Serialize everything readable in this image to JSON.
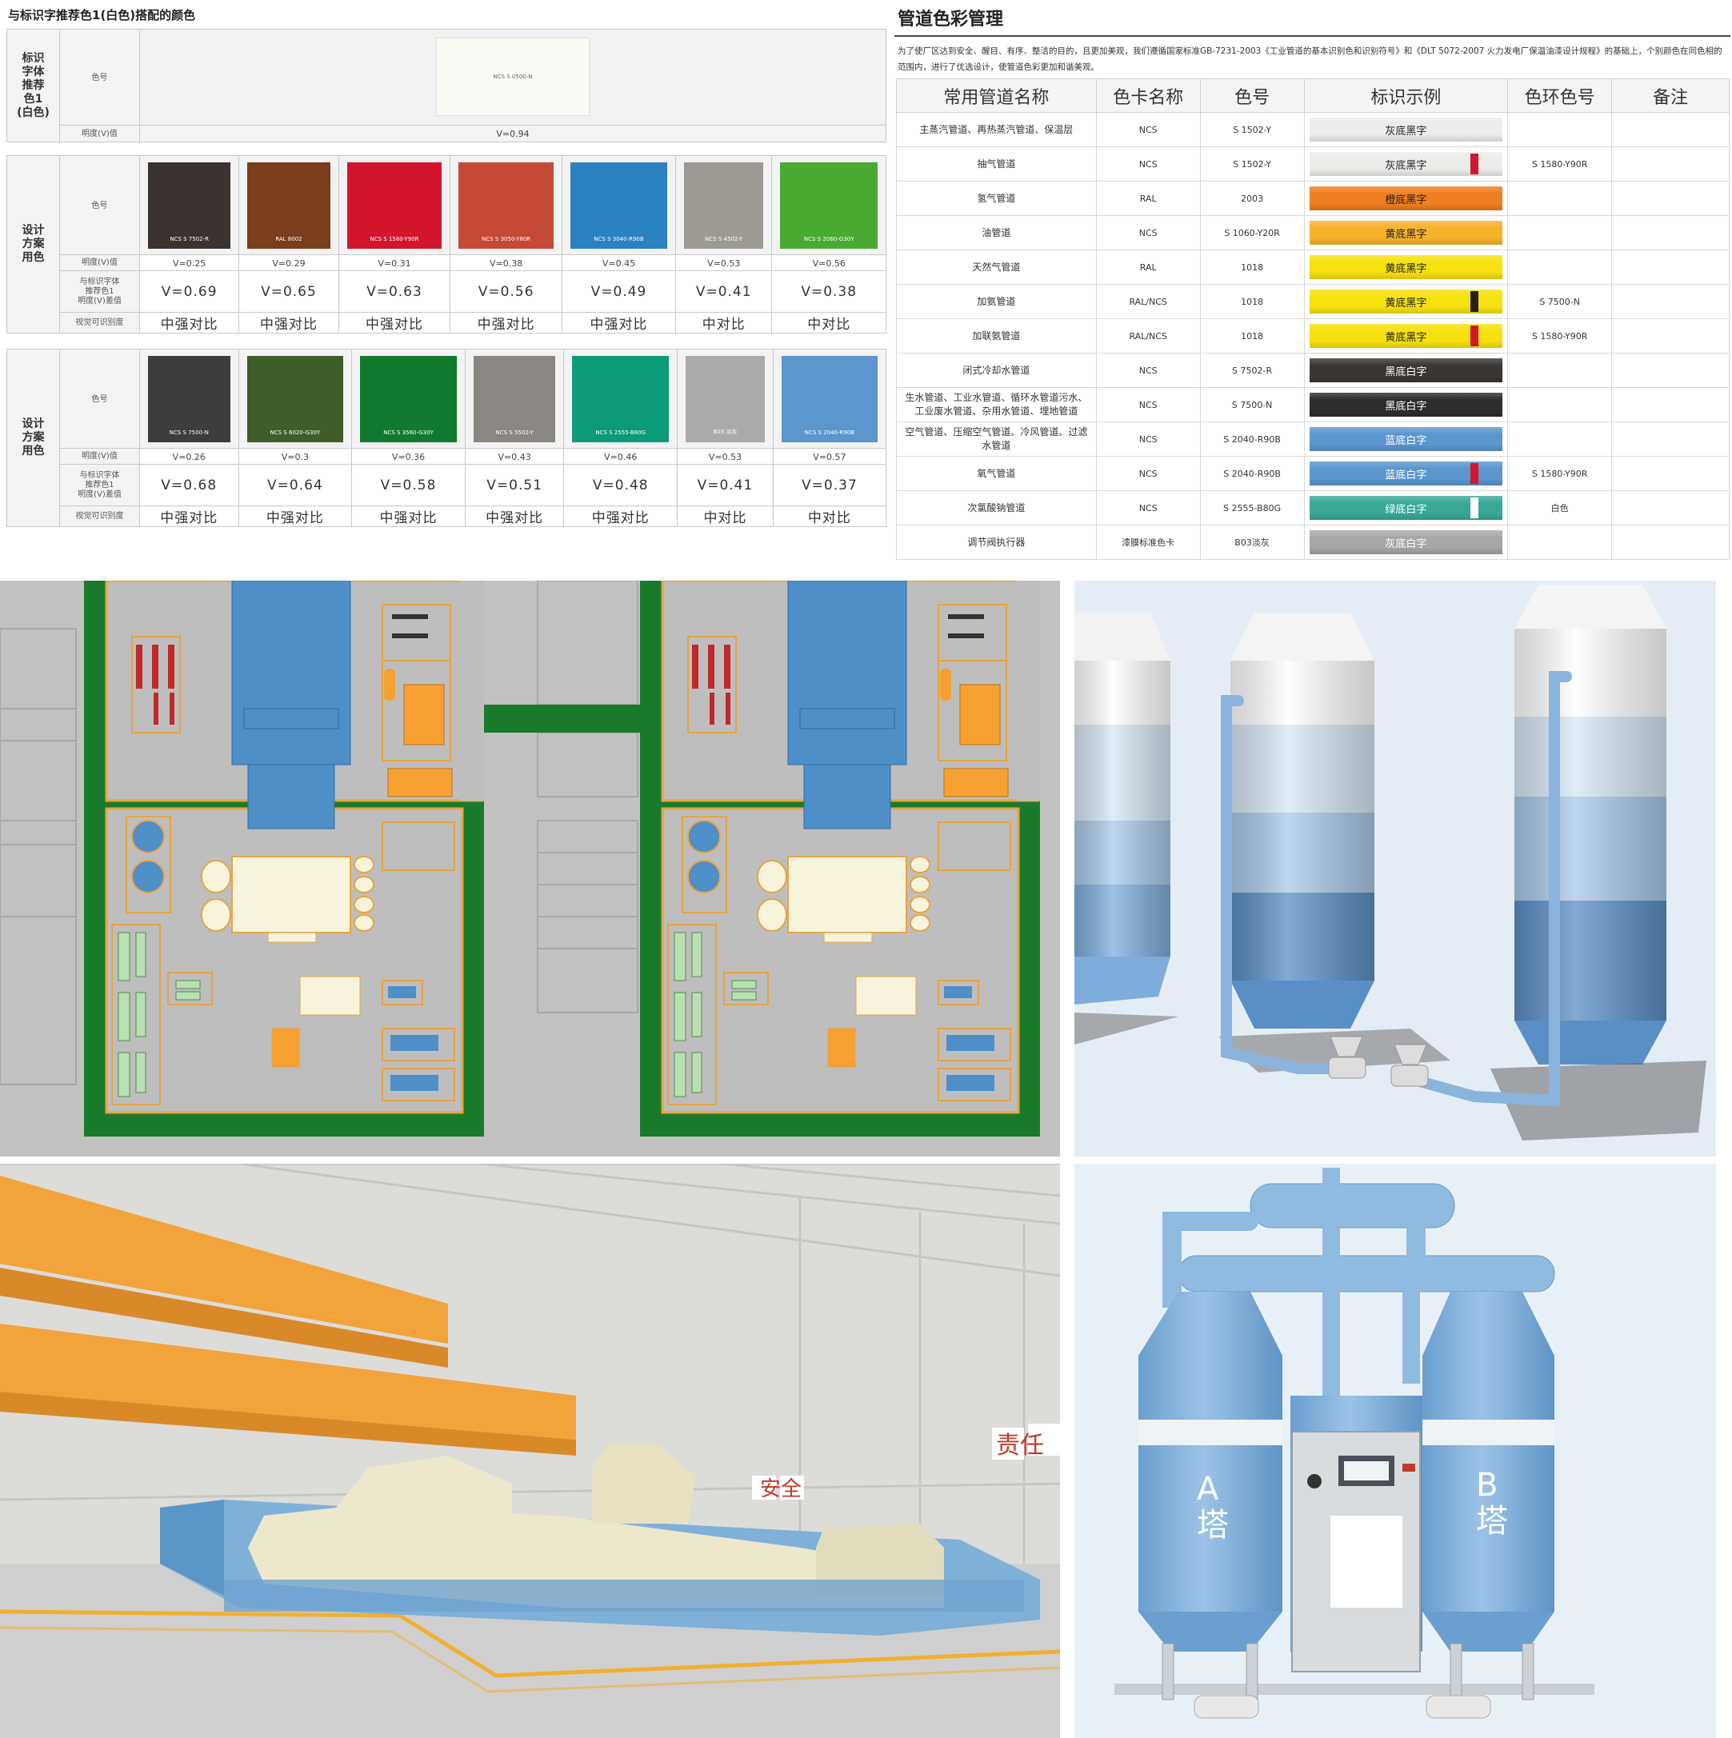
{
  "left_table": {
    "title": "与标识字推荐色1(白色)搭配的颜色",
    "white": {
      "label": "标识\n字体\n推荐\n色1\n(白色)",
      "code_label": "色号",
      "swatch_code": "NCS S 0500-N",
      "swatch_color": "#fbfaf4",
      "v_label": "明度(V)值",
      "v_value": "V=0.94"
    },
    "row_labels": {
      "code": "色号",
      "v": "明度(V)值",
      "diff": "与标识字体\n推荐色1\n明度(V)差值",
      "contrast": "视觉可识别度"
    },
    "schemes": [
      {
        "label": "设计\n方案\n用色",
        "colors": [
          {
            "code": "NCS S 7502-R",
            "hex": "#3a3330",
            "v": "V=0.25",
            "diff": "V=0.69",
            "contrast": "中强对比"
          },
          {
            "code": "RAL 8002",
            "hex": "#7a3e1c",
            "v": "V=0.29",
            "diff": "V=0.65",
            "contrast": "中强对比"
          },
          {
            "code": "NCS S 1580-Y90R",
            "hex": "#d4162d",
            "v": "V=0.31",
            "diff": "V=0.63",
            "contrast": "中强对比"
          },
          {
            "code": "NCS S 3050-Y80R",
            "hex": "#c44a35",
            "v": "V=0.38",
            "diff": "V=0.56",
            "contrast": "中强对比"
          },
          {
            "code": "NCS S 3040-R90B",
            "hex": "#2a82c0",
            "v": "V=0.45",
            "diff": "V=0.49",
            "contrast": "中强对比"
          },
          {
            "code": "NCS S 4502-Y",
            "hex": "#9c9a92",
            "v": "V=0.53",
            "diff": "V=0.41",
            "contrast": "中对比"
          },
          {
            "code": "NCS S 2060-G30Y",
            "hex": "#49aa32",
            "v": "V=0.56",
            "diff": "V=0.38",
            "contrast": "中对比"
          }
        ]
      },
      {
        "label": "设计\n方案\n用色",
        "colors": [
          {
            "code": "NCS S 7500-N",
            "hex": "#3d3d3f",
            "v": "V=0.26",
            "diff": "V=0.68",
            "contrast": "中强对比"
          },
          {
            "code": "NCS S 6020-G30Y",
            "hex": "#3f5e2a",
            "v": "V=0.3",
            "diff": "V=0.64",
            "contrast": "中强对比"
          },
          {
            "code": "NCS S 3560-G30Y",
            "hex": "#117a2e",
            "v": "V=0.36",
            "diff": "V=0.58",
            "contrast": "中强对比"
          },
          {
            "code": "NCS S 5502-Y",
            "hex": "#8a8782",
            "v": "V=0.43",
            "diff": "V=0.51",
            "contrast": "中强对比"
          },
          {
            "code": "NCS S 2555-B80G",
            "hex": "#0b9b78",
            "v": "V=0.46",
            "diff": "V=0.48",
            "contrast": "中强对比"
          },
          {
            "code": "B03 淡灰",
            "hex": "#a9aaa9",
            "v": "V=0.53",
            "diff": "V=0.41",
            "contrast": "中对比"
          },
          {
            "code": "NCS S 2040-R90B",
            "hex": "#5b96cf",
            "v": "V=0.57",
            "diff": "V=0.37",
            "contrast": "中对比"
          }
        ]
      }
    ]
  },
  "right_table": {
    "title": "管道色彩管理",
    "intro": "为了使厂区达到安全、醒目、有序、整洁的目的，且更加美观，我们遵循国家标准GB-7231-2003《工业管道的基本识别色和识别符号》和《DLT 5072-2007 火力发电厂保温油漆设计规程》的基础上，个别颜色在同色相的范围内，进行了优选设计，使管道色彩更加和谐美观。",
    "headers": [
      "常用管道名称",
      "色卡名称",
      "色号",
      "标识示例",
      "色环色号",
      "备注"
    ],
    "rows": [
      {
        "name": "主蒸汽管道、再热蒸汽管道、保温层",
        "card": "NCS",
        "code": "S 1502-Y",
        "label": "灰底黑字",
        "bg": "#ececea",
        "fg": "#222",
        "ring": "",
        "ring_code": ""
      },
      {
        "name": "抽气管道",
        "card": "NCS",
        "code": "S 1502-Y",
        "label": "灰底黑字",
        "bg": "#ececea",
        "fg": "#222",
        "ring": "#d4162d",
        "ring_code": "S 1580-Y90R"
      },
      {
        "name": "氢气管道",
        "card": "RAL",
        "code": "2003",
        "label": "橙底黑字",
        "bg": "#f07f22",
        "fg": "#222",
        "ring": "",
        "ring_code": ""
      },
      {
        "name": "油管道",
        "card": "NCS",
        "code": "S 1060-Y20R",
        "label": "黄底黑字",
        "bg": "#f7b22c",
        "fg": "#222",
        "ring": "",
        "ring_code": ""
      },
      {
        "name": "天然气管道",
        "card": "RAL",
        "code": "1018",
        "label": "黄底黑字",
        "bg": "#f6e10f",
        "fg": "#222",
        "ring": "",
        "ring_code": ""
      },
      {
        "name": "加氨管道",
        "card": "RAL/NCS",
        "code": "1018",
        "label": "黄底黑字",
        "bg": "#f6e10f",
        "fg": "#222",
        "ring": "#222",
        "ring_code": "S 7500-N"
      },
      {
        "name": "加联氨管道",
        "card": "RAL/NCS",
        "code": "1018",
        "label": "黄底黑字",
        "bg": "#f6e10f",
        "fg": "#222",
        "ring": "#d4162d",
        "ring_code": "S 1580-Y90R"
      },
      {
        "name": "闭式冷却水管道",
        "card": "NCS",
        "code": "S 7502-R",
        "label": "黑底白字",
        "bg": "#3a3634",
        "fg": "#fff",
        "ring": "",
        "ring_code": ""
      },
      {
        "name": "生水管道、工业水管道、循环水管道污水、工业废水管道、杂用水管道、埋地管道",
        "card": "NCS",
        "code": "S 7500-N",
        "label": "黑底白字",
        "bg": "#2e2e30",
        "fg": "#fff",
        "ring": "",
        "ring_code": ""
      },
      {
        "name": "空气管道、压缩空气管道、冷风管道、过滤水管道",
        "card": "NCS",
        "code": "S 2040-R90B",
        "label": "蓝底白字",
        "bg": "#5b96cf",
        "fg": "#fff",
        "ring": "",
        "ring_code": ""
      },
      {
        "name": "氧气管道",
        "card": "NCS",
        "code": "S 2040-R90B",
        "label": "蓝底白字",
        "bg": "#5b96cf",
        "fg": "#fff",
        "ring": "#d4162d",
        "ring_code": "S 1580-Y90R"
      },
      {
        "name": "次氯酸钠管道",
        "card": "NCS",
        "code": "S 2555-B80G",
        "label": "绿底白字",
        "bg": "#3aa896",
        "fg": "#fff",
        "ring": "#ffffff",
        "ring_code": "白色"
      },
      {
        "name": "调节阀执行器",
        "card": "漆膜标准色卡",
        "code": "B03淡灰",
        "label": "灰底白字",
        "bg": "#a6a7a6",
        "fg": "#fff",
        "ring": "",
        "ring_code": ""
      }
    ]
  },
  "hall_signs": [
    "安全",
    "责任"
  ],
  "dryer_towers": [
    "A\n塔",
    "B\n塔"
  ],
  "colors": {
    "plant_green": "#1a7a2c",
    "floor_gray": "#bebebe",
    "equipment_blue": "#5b96cf",
    "crane_orange": "#f0a43a",
    "outline_orange": "#f5a623"
  }
}
